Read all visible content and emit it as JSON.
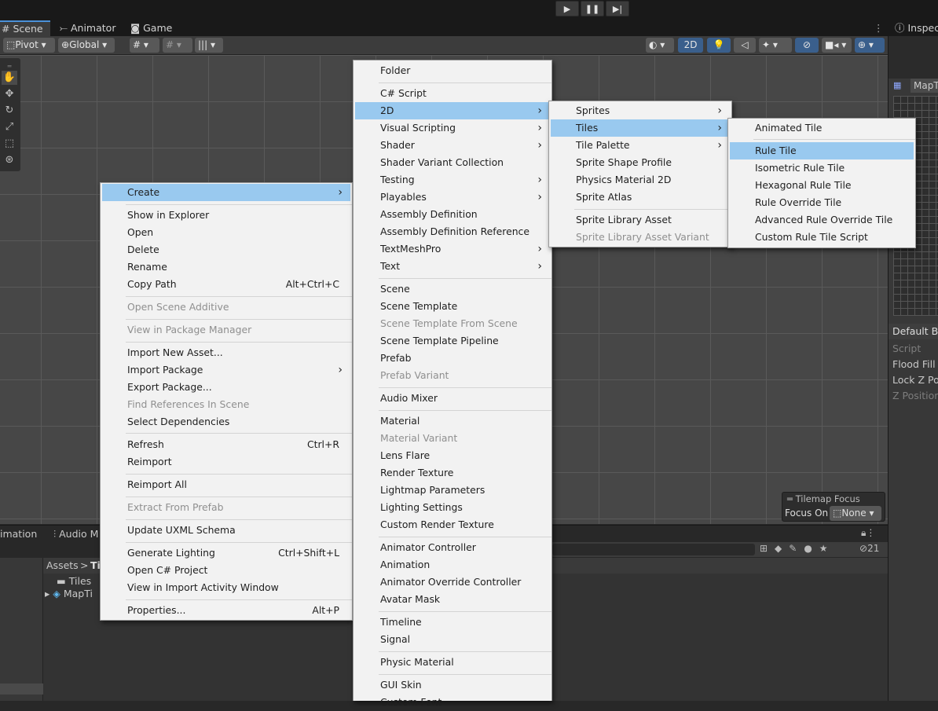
{
  "playbar": {
    "play": "▶",
    "pause": "❚❚",
    "step": "▶|"
  },
  "tabs": {
    "scene": "# Scene",
    "animator": "Animator",
    "game": "Game",
    "inspector": "Inspect"
  },
  "toolbar": {
    "pivot": "Pivot",
    "global": "Global",
    "mode2d": "2D"
  },
  "inspector": {
    "object": "MapT",
    "brush": "Default Br",
    "rows": [
      "Script",
      "Flood Fill C",
      "Lock Z Pos",
      "Z Position"
    ]
  },
  "focus": {
    "title": "Tilemap Focus",
    "label": "Focus On",
    "value": "None"
  },
  "bottom": {
    "tab_animation": "imation",
    "tab_audio": "Audio M",
    "hidden_count": "21",
    "breadcrumb_root": "Assets",
    "breadcrumb_sep": ">",
    "breadcrumb_child": "Til",
    "folder": "Tiles",
    "asset": "MapTi"
  },
  "context_menu": {
    "items": [
      {
        "label": "Create",
        "shortcut": "",
        "arrow": true
      },
      {
        "label": "Show in Explorer"
      },
      {
        "label": "Open"
      },
      {
        "label": "Delete"
      },
      {
        "label": "Rename"
      },
      {
        "label": "Copy Path",
        "shortcut": "Alt+Ctrl+C"
      },
      {
        "label": "Open Scene Additive"
      },
      {
        "label": "View in Package Manager"
      },
      {
        "label": "Import New Asset..."
      },
      {
        "label": "Import Package",
        "arrow": true
      },
      {
        "label": "Export Package..."
      },
      {
        "label": "Find References In Scene"
      },
      {
        "label": "Select Dependencies"
      },
      {
        "label": "Refresh",
        "shortcut": "Ctrl+R"
      },
      {
        "label": "Reimport"
      },
      {
        "label": "Reimport All"
      },
      {
        "label": "Extract From Prefab"
      },
      {
        "label": "Update UXML Schema"
      },
      {
        "label": "Generate Lighting",
        "shortcut": "Ctrl+Shift+L"
      },
      {
        "label": "Open C# Project"
      },
      {
        "label": "View in Import Activity Window"
      },
      {
        "label": "Properties...",
        "shortcut": "Alt+P"
      }
    ]
  },
  "create_menu": {
    "items": [
      {
        "label": "Folder"
      },
      {
        "label": "C# Script"
      },
      {
        "label": "2D"
      },
      {
        "label": "Visual Scripting"
      },
      {
        "label": "Shader"
      },
      {
        "label": "Shader Variant Collection"
      },
      {
        "label": "Testing"
      },
      {
        "label": "Playables"
      },
      {
        "label": "Assembly Definition"
      },
      {
        "label": "Assembly Definition Reference"
      },
      {
        "label": "TextMeshPro"
      },
      {
        "label": "Text"
      },
      {
        "label": "Scene"
      },
      {
        "label": "Scene Template"
      },
      {
        "label": "Scene Template From Scene"
      },
      {
        "label": "Scene Template Pipeline"
      },
      {
        "label": "Prefab"
      },
      {
        "label": "Prefab Variant"
      },
      {
        "label": "Audio Mixer"
      },
      {
        "label": "Material"
      },
      {
        "label": "Material Variant"
      },
      {
        "label": "Lens Flare"
      },
      {
        "label": "Render Texture"
      },
      {
        "label": "Lightmap Parameters"
      },
      {
        "label": "Lighting Settings"
      },
      {
        "label": "Custom Render Texture"
      },
      {
        "label": "Animator Controller"
      },
      {
        "label": "Animation"
      },
      {
        "label": "Animator Override Controller"
      },
      {
        "label": "Avatar Mask"
      },
      {
        "label": "Timeline"
      },
      {
        "label": "Signal"
      },
      {
        "label": "Physic Material"
      },
      {
        "label": "GUI Skin"
      },
      {
        "label": "Custom Font"
      }
    ]
  },
  "twod_menu": {
    "items": [
      {
        "label": "Sprites"
      },
      {
        "label": "Tiles"
      },
      {
        "label": "Tile Palette"
      },
      {
        "label": "Sprite Shape Profile"
      },
      {
        "label": "Physics Material 2D"
      },
      {
        "label": "Sprite Atlas"
      },
      {
        "label": "Sprite Library Asset"
      },
      {
        "label": "Sprite Library Asset Variant"
      }
    ]
  },
  "tiles_menu": {
    "items": [
      {
        "label": "Animated Tile"
      },
      {
        "label": "Rule Tile"
      },
      {
        "label": "Isometric Rule Tile"
      },
      {
        "label": "Hexagonal Rule Tile"
      },
      {
        "label": "Rule Override Tile"
      },
      {
        "label": "Advanced Rule Override Tile"
      },
      {
        "label": "Custom Rule Tile Script"
      }
    ]
  },
  "colors": {
    "highlight": "#99c9ef",
    "menu_bg": "#f2f2f2",
    "disabled": "#8f8f8f",
    "toolbar_active": "#3a5f8c"
  }
}
